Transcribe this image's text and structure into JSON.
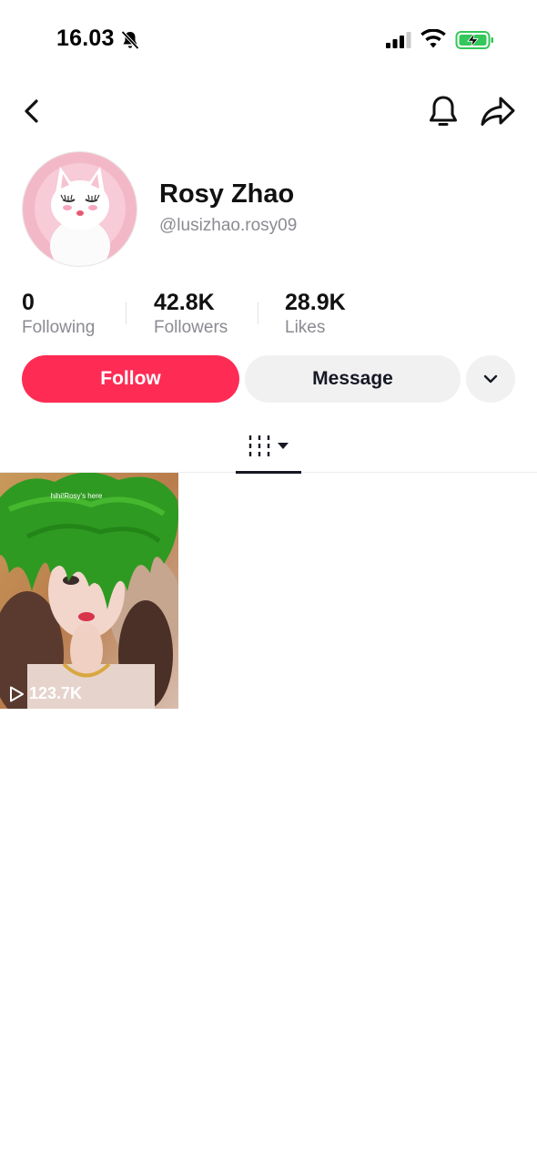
{
  "status_bar": {
    "time": "16.03",
    "icons": [
      "bell-off-icon",
      "cellular-signal-icon",
      "wifi-icon",
      "battery-charging-icon"
    ],
    "battery_color": "#34c759"
  },
  "nav": {
    "icons": [
      "back-chevron-icon",
      "notification-bell-icon",
      "share-arrow-icon"
    ]
  },
  "profile": {
    "display_name": "Rosy Zhao",
    "username": "@lusizhao.rosy09",
    "avatar_icon": "white-fluffy-cat-avatar"
  },
  "stats": [
    {
      "value": "0",
      "label": "Following"
    },
    {
      "value": "42.8K",
      "label": "Followers"
    },
    {
      "value": "28.9K",
      "label": "Likes"
    }
  ],
  "actions": {
    "follow_label": "Follow",
    "message_label": "Message",
    "more_icon": "chevron-down-icon",
    "follow_color": "#fe2c55"
  },
  "tabs": {
    "active": "videos-grid-icon"
  },
  "videos": [
    {
      "caption": "hihi!Rosy's here",
      "views": "123.7K"
    }
  ]
}
